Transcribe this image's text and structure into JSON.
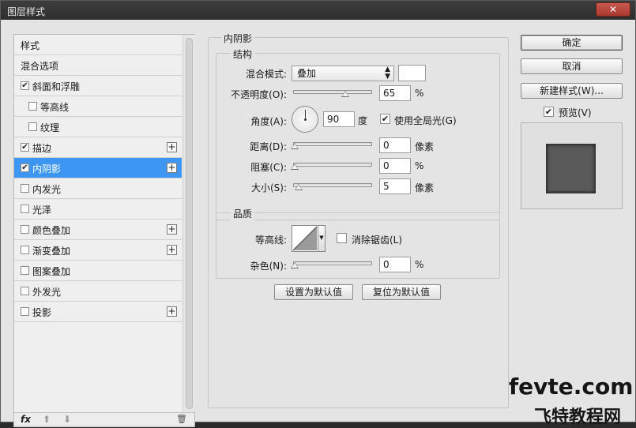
{
  "window": {
    "title": "图层样式",
    "close_label": "✕"
  },
  "left_panel": {
    "items": [
      {
        "label": "样式",
        "checkbox": false,
        "checked": false,
        "plus": false,
        "indent": false
      },
      {
        "label": "混合选项",
        "checkbox": false,
        "checked": false,
        "plus": false,
        "indent": false
      },
      {
        "label": "斜面和浮雕",
        "checkbox": true,
        "checked": true,
        "plus": false,
        "indent": false
      },
      {
        "label": "等高线",
        "checkbox": true,
        "checked": false,
        "plus": false,
        "indent": true
      },
      {
        "label": "纹理",
        "checkbox": true,
        "checked": false,
        "plus": false,
        "indent": true
      },
      {
        "label": "描边",
        "checkbox": true,
        "checked": true,
        "plus": true,
        "indent": false
      },
      {
        "label": "内阴影",
        "checkbox": true,
        "checked": true,
        "plus": true,
        "indent": false,
        "selected": true
      },
      {
        "label": "内发光",
        "checkbox": true,
        "checked": false,
        "plus": false,
        "indent": false
      },
      {
        "label": "光泽",
        "checkbox": true,
        "checked": false,
        "plus": false,
        "indent": false
      },
      {
        "label": "颜色叠加",
        "checkbox": true,
        "checked": false,
        "plus": true,
        "indent": false
      },
      {
        "label": "渐变叠加",
        "checkbox": true,
        "checked": false,
        "plus": true,
        "indent": false
      },
      {
        "label": "图案叠加",
        "checkbox": true,
        "checked": false,
        "plus": false,
        "indent": false
      },
      {
        "label": "外发光",
        "checkbox": true,
        "checked": false,
        "plus": false,
        "indent": false
      },
      {
        "label": "投影",
        "checkbox": true,
        "checked": false,
        "plus": true,
        "indent": false
      }
    ],
    "footer": {
      "fx": "fx",
      "up": "⬆",
      "down": "⬇",
      "trash": "🗑"
    }
  },
  "inner_shadow": {
    "title": "内阴影",
    "structure": {
      "title": "结构",
      "blend_mode_label": "混合模式:",
      "blend_mode_value": "叠加",
      "opacity_label": "不透明度(O):",
      "opacity_value": "65",
      "percent": "%",
      "angle_label": "角度(A):",
      "angle_value": "90",
      "degree": "度",
      "global_light_label": "使用全局光(G)",
      "global_light_checked": true,
      "distance_label": "距离(D):",
      "distance_value": "0",
      "pixels": "像素",
      "choke_label": "阻塞(C):",
      "choke_value": "0",
      "size_label": "大小(S):",
      "size_value": "5"
    },
    "quality": {
      "title": "品质",
      "contour_label": "等高线:",
      "antialias_label": "消除锯齿(L)",
      "antialias_checked": false,
      "noise_label": "杂色(N):",
      "noise_value": "0"
    },
    "make_default_label": "设置为默认值",
    "reset_default_label": "复位为默认值"
  },
  "side_buttons": {
    "ok": "确定",
    "cancel": "取消",
    "new_style": "新建样式(W)...",
    "preview_label": "预览(V)",
    "preview_checked": true
  },
  "watermark": {
    "line1": "fevte.com",
    "line2": "飞特教程网"
  },
  "colors": {
    "selection": "#3d97f2",
    "preview_swatch": "#5a5a5a"
  }
}
